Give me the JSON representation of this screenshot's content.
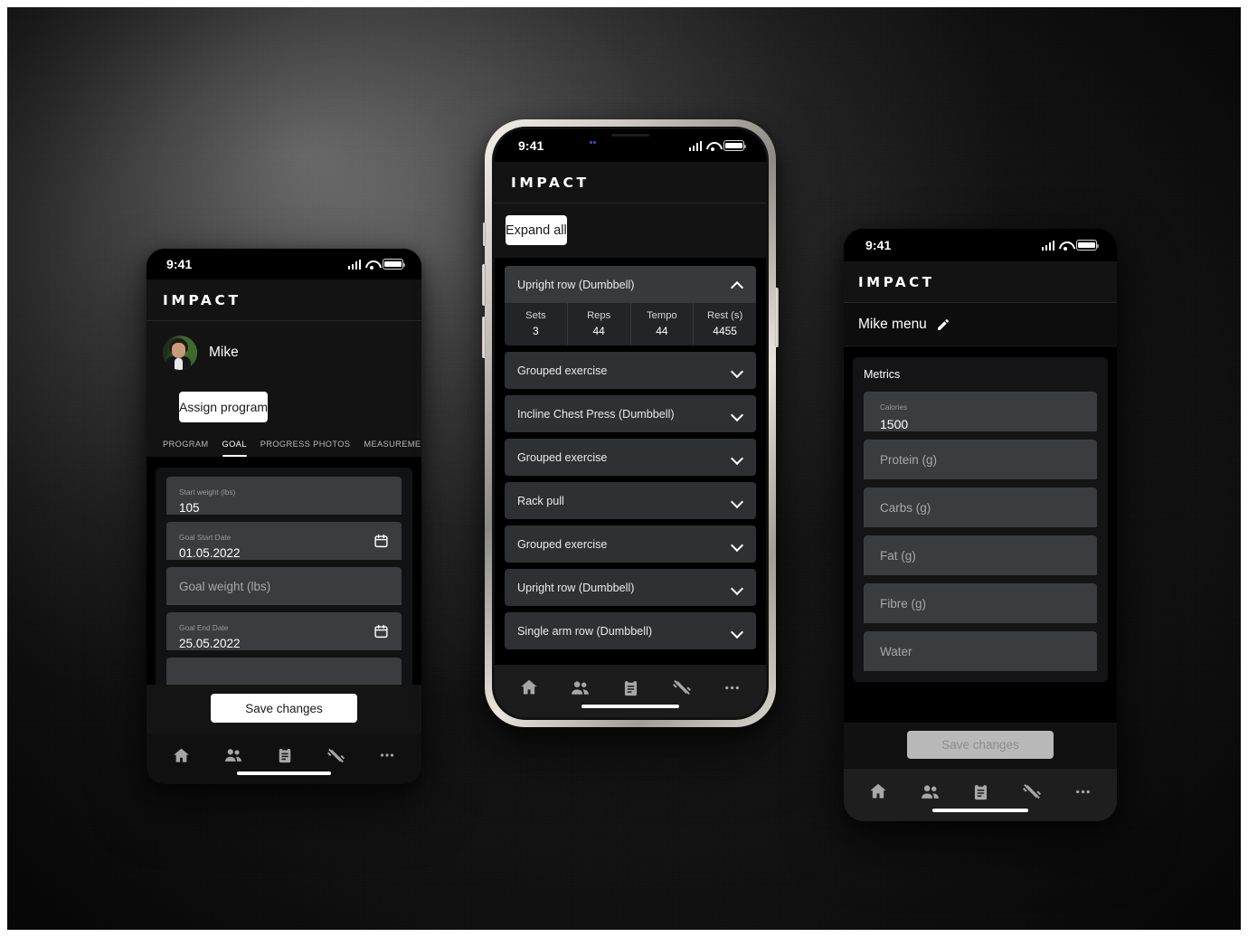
{
  "app": {
    "brand": "IMPACT"
  },
  "status_bar": {
    "time": "9:41",
    "icons": [
      "cellular-signal-icon",
      "wifi-icon",
      "battery-icon"
    ]
  },
  "nav": {
    "items": [
      {
        "name": "home",
        "icon": "home-icon"
      },
      {
        "name": "clients",
        "icon": "people-icon"
      },
      {
        "name": "programs",
        "icon": "clipboard-icon"
      },
      {
        "name": "workouts",
        "icon": "dumbbell-icon"
      },
      {
        "name": "more",
        "icon": "ellipsis-icon"
      }
    ]
  },
  "screen_left": {
    "profile": {
      "name": "Mike",
      "avatar": "user-avatar"
    },
    "assign_button": "Assign program",
    "tabs": [
      {
        "label": "PROGRAM",
        "active": false
      },
      {
        "label": "GOAL",
        "active": true
      },
      {
        "label": "PROGRESS PHOTOS",
        "active": false
      },
      {
        "label": "MEASUREMENTS",
        "active": false
      }
    ],
    "fields": [
      {
        "label": "Start weight (lbs)",
        "value": "105",
        "placeholder": "",
        "type": "text"
      },
      {
        "label": "Goal Start Date",
        "value": "01.05.2022",
        "placeholder": "",
        "type": "date",
        "icon": "calendar-icon"
      },
      {
        "label": "",
        "value": "",
        "placeholder": "Goal weight (lbs)",
        "type": "text"
      },
      {
        "label": "Goal End Date",
        "value": "25.05.2022",
        "placeholder": "",
        "type": "date",
        "icon": "calendar-icon"
      }
    ],
    "save_button": "Save changes"
  },
  "screen_center": {
    "expand_all_button": "Expand all",
    "exercises": [
      {
        "title": "Upright row (Dumbbell)",
        "expanded": true,
        "chevron": "chevron-up-icon",
        "table": {
          "headers": [
            "Sets",
            "Reps",
            "Tempo",
            "Rest (s)"
          ],
          "values": [
            "3",
            "44",
            "44",
            "4455"
          ]
        }
      },
      {
        "title": "Grouped exercise",
        "expanded": false,
        "chevron": "chevron-down-icon"
      },
      {
        "title": "Incline Chest Press (Dumbbell)",
        "expanded": false,
        "chevron": "chevron-down-icon"
      },
      {
        "title": "Grouped exercise",
        "expanded": false,
        "chevron": "chevron-down-icon"
      },
      {
        "title": "Rack pull",
        "expanded": false,
        "chevron": "chevron-down-icon"
      },
      {
        "title": "Grouped exercise",
        "expanded": false,
        "chevron": "chevron-down-icon"
      },
      {
        "title": "Upright row (Dumbbell)",
        "expanded": false,
        "chevron": "chevron-down-icon"
      },
      {
        "title": "Single arm row (Dumbbell)",
        "expanded": false,
        "chevron": "chevron-down-icon"
      }
    ]
  },
  "screen_right": {
    "menu_title": "Mike menu",
    "edit_icon": "pencil-icon",
    "card_title": "Metrics",
    "fields": [
      {
        "label": "Calories",
        "value": "1500",
        "placeholder": ""
      },
      {
        "label": "",
        "value": "",
        "placeholder": "Protein (g)"
      },
      {
        "label": "",
        "value": "",
        "placeholder": "Carbs (g)"
      },
      {
        "label": "",
        "value": "",
        "placeholder": "Fat (g)"
      },
      {
        "label": "",
        "value": "",
        "placeholder": "Fibre (g)"
      },
      {
        "label": "",
        "value": "",
        "placeholder": "Water"
      }
    ],
    "save_button": "Save changes",
    "save_disabled": true
  },
  "colors": {
    "accent": "#ffffff",
    "screen_bg": "#000000",
    "field_bg": "#3a3c40",
    "card_bg": "#141416",
    "exercise_bg": "#2e3033",
    "disabled_button": "#b9b9b9"
  }
}
